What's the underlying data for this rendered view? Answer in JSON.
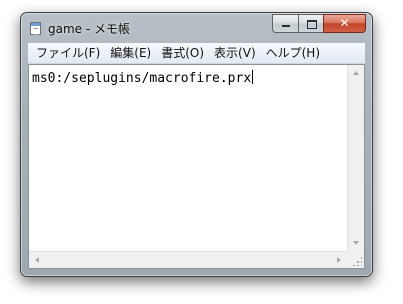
{
  "window": {
    "title": "game - メモ帳",
    "icons": {
      "app": "notepad-icon",
      "minimize": "minimize-icon",
      "maximize": "maximize-icon",
      "close": "close-icon"
    },
    "close_glyph": "✕"
  },
  "menubar": {
    "items": [
      {
        "label": "ファイル(F)"
      },
      {
        "label": "編集(E)"
      },
      {
        "label": "書式(O)"
      },
      {
        "label": "表示(V)"
      },
      {
        "label": "ヘルプ(H)"
      }
    ]
  },
  "editor": {
    "content": "ms0:/seplugins/macrofire.prx"
  },
  "colors": {
    "frame": "#a7b1b7",
    "close_button": "#c4462b",
    "menubar": "#e3eaf3"
  }
}
